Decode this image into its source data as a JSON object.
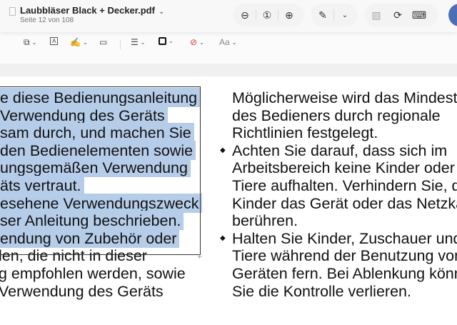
{
  "window": {
    "title": "Laubbläser Black + Decker.pdf",
    "subtitle": "Seite 12 von 108"
  },
  "toolbar": {
    "zoom_out": "zoom-out",
    "actual_size": "actual-size",
    "zoom_in": "zoom-in",
    "highlight": "highlight",
    "more": "more",
    "redact": "redact",
    "rotate": "rotate",
    "markup": "markup"
  },
  "markup_bar": {
    "text_style": "Aa"
  },
  "document": {
    "left_column": [
      {
        "text": "e diese Bedienungsanleitung",
        "selected": true
      },
      {
        "text": "Verwendung des Geräts",
        "selected": true
      },
      {
        "text": "sam durch, und machen Sie",
        "selected": true
      },
      {
        "text": "den Bedienelementen sowie",
        "selected": true
      },
      {
        "text": "ungsgemäßen Verwendung",
        "selected": true
      },
      {
        "text": "äts vertraut.",
        "selected": true
      },
      {
        "text": "esehene Verwendungszweck",
        "selected": true
      },
      {
        "text": "ser Anleitung beschrieben.",
        "selected": true
      },
      {
        "text": "endung von Zubehör oder",
        "selected": true
      },
      {
        "text": "len, die nicht in dieser",
        "selected": false
      },
      {
        "text": "g empfohlen werden, sowie",
        "selected": false
      },
      {
        "text": "Verwendung des Geräts",
        "selected": false
      }
    ],
    "right_column": [
      {
        "text": "Möglicherweise wird das Mindestal",
        "bullet": false
      },
      {
        "text": "des Bedieners durch regionale",
        "bullet": false
      },
      {
        "text": "Richtlinien festgelegt.",
        "bullet": false
      },
      {
        "text": "Achten Sie darauf, dass sich im",
        "bullet": true
      },
      {
        "text": "Arbeitsbereich keine Kinder oder",
        "bullet": false
      },
      {
        "text": "Tiere aufhalten. Verhindern Sie, da",
        "bullet": false
      },
      {
        "text": "Kinder das Gerät oder das Netzkab",
        "bullet": false
      },
      {
        "text": "berühren.",
        "bullet": false
      },
      {
        "text": "Halten Sie Kinder, Zuschauer und",
        "bullet": true
      },
      {
        "text": "Tiere während der Benutzung von",
        "bullet": false
      },
      {
        "text": "Geräten fern. Bei Ablenkung könne",
        "bullet": false
      },
      {
        "text": "Sie die Kontrolle verlieren.",
        "bullet": false
      }
    ],
    "bullet_glyph": "◆"
  },
  "colors": {
    "selection": "#b6cdea",
    "avatar": "#4a6fb5"
  }
}
